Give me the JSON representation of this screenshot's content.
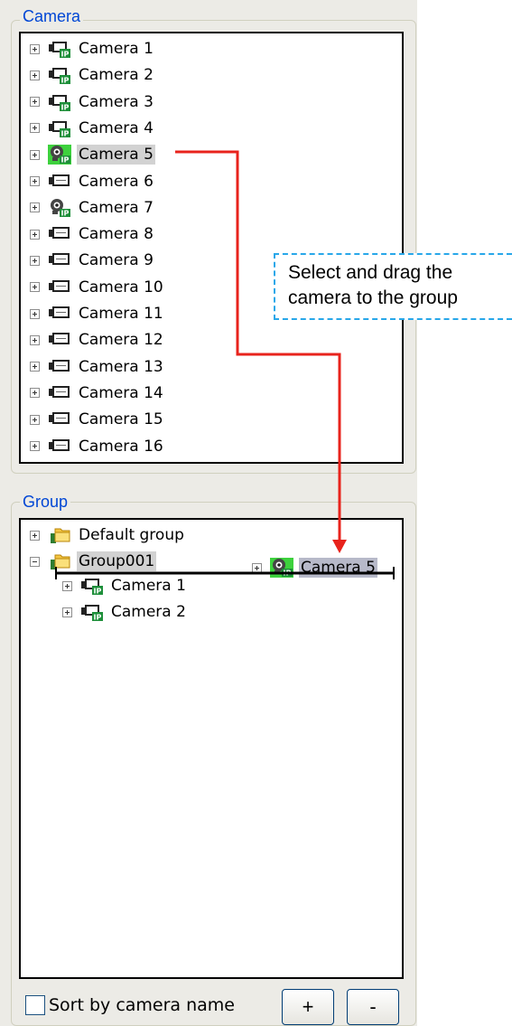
{
  "camera_panel": {
    "title": "Camera",
    "items": [
      {
        "label": "Camera 1",
        "icon": "ip-camera-icon"
      },
      {
        "label": "Camera 2",
        "icon": "ip-camera-icon"
      },
      {
        "label": "Camera 3",
        "icon": "ip-camera-icon"
      },
      {
        "label": "Camera 4",
        "icon": "ip-camera-icon"
      },
      {
        "label": "Camera 5",
        "icon": "ip-dome-camera-icon",
        "selected": true
      },
      {
        "label": "Camera 6",
        "icon": "analog-camera-icon"
      },
      {
        "label": "Camera 7",
        "icon": "ip-dome-camera-icon"
      },
      {
        "label": "Camera 8",
        "icon": "analog-camera-icon"
      },
      {
        "label": "Camera 9",
        "icon": "analog-camera-icon"
      },
      {
        "label": "Camera 10",
        "icon": "analog-camera-icon"
      },
      {
        "label": "Camera 11",
        "icon": "analog-camera-icon"
      },
      {
        "label": "Camera 12",
        "icon": "analog-camera-icon"
      },
      {
        "label": "Camera 13",
        "icon": "analog-camera-icon"
      },
      {
        "label": "Camera 14",
        "icon": "analog-camera-icon"
      },
      {
        "label": "Camera 15",
        "icon": "analog-camera-icon"
      },
      {
        "label": "Camera 16",
        "icon": "analog-camera-icon"
      }
    ]
  },
  "group_panel": {
    "title": "Group",
    "groups": [
      {
        "label": "Default group",
        "expanded": false
      },
      {
        "label": "Group001",
        "expanded": true,
        "selected": true,
        "children": [
          {
            "label": "Camera 1"
          },
          {
            "label": "Camera 2"
          }
        ]
      }
    ],
    "drag_item": {
      "label": "Camera 5"
    }
  },
  "annotation": {
    "text": "Select and drag the camera to the group"
  },
  "footer": {
    "sort_label": "Sort by camera name",
    "sort_checked": false,
    "add_label": "+",
    "remove_label": "-"
  },
  "colors": {
    "accent_arrow": "#e8231c",
    "callout_border": "#28a7e9",
    "legend_text": "#0046d5",
    "selection": "#d2d2d2"
  }
}
